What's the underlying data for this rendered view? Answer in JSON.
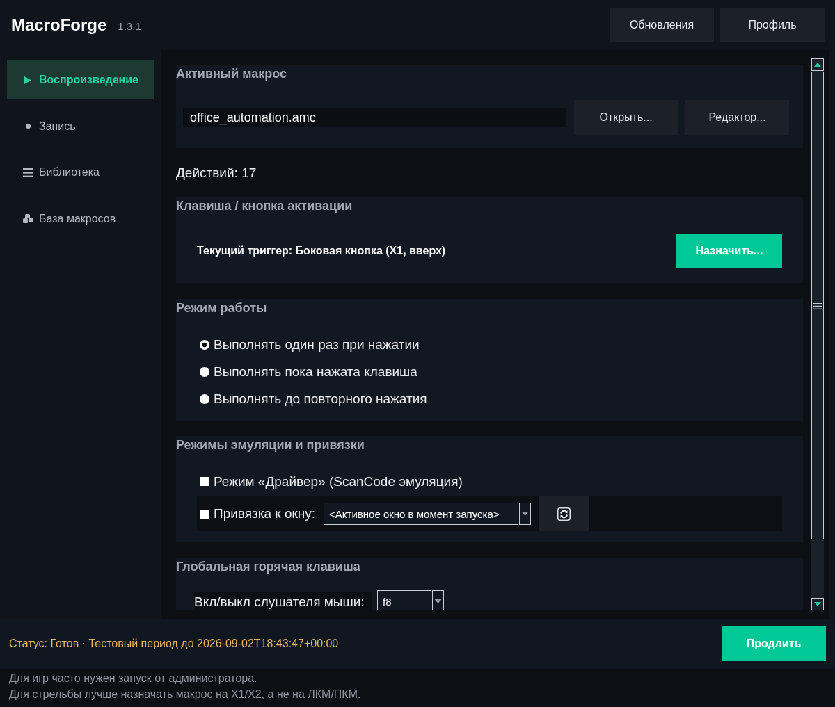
{
  "app": {
    "name": "MacroForge",
    "version": "1.3.1"
  },
  "header_buttons": [
    {
      "label": "Обновления"
    },
    {
      "label": "Профиль"
    }
  ],
  "sidebar": {
    "items": [
      {
        "label": "Воспроизведение",
        "kind": "play",
        "selected": true
      },
      {
        "label": "Запись",
        "kind": "dot",
        "selected": false
      },
      {
        "label": "Библиотека",
        "kind": "list",
        "selected": false
      },
      {
        "label": "База макросов",
        "kind": "blocks",
        "selected": false
      }
    ]
  },
  "active_macro": {
    "title": "Активный макрос",
    "file": {
      "value": "office_automation.amc"
    },
    "buttons": [
      {
        "label": "Открыть..."
      },
      {
        "label": "Редактор..."
      }
    ]
  },
  "actions_count": "Действий: 17",
  "trigger": {
    "title": "Клавиша / кнопка активации",
    "current": "Текущий триггер: Боковая кнопка (X1, вверх)",
    "button": "Назначить..."
  },
  "work_mode": {
    "title": "Режим работы",
    "options": [
      {
        "label": "Выполнять один раз при нажатии",
        "selected": true
      },
      {
        "label": "Выполнять пока нажата клавиша",
        "selected": false
      },
      {
        "label": "Выполнять до повторного нажатия",
        "selected": false
      }
    ]
  },
  "emulation": {
    "title": "Режимы эмуляции и привязки",
    "driver_mode": {
      "label": "Режим «Драйвер» (ScanCode эмуляция)",
      "checked": false
    },
    "window_binding": {
      "label": "Привязка к окну:",
      "checked": false,
      "target": {
        "value": "<Активное окно в момент запуска>"
      }
    }
  },
  "global_hotkey": {
    "title": "Глобальная горячая клавиша",
    "rows": [
      {
        "label": "Вкл/выкл слушателя мыши:",
        "value": "f8"
      }
    ]
  },
  "status_bar": {
    "status": "Статус: Готов · Тестовый период до 2026-09-02T18:43:47+00:00",
    "button": "Продлить"
  },
  "tips": [
    "Для игр часто нужен запуск от администратора.",
    "Для стрельбы лучше назначать макрос на X1/X2, а не на ЛКМ/ПКМ."
  ]
}
